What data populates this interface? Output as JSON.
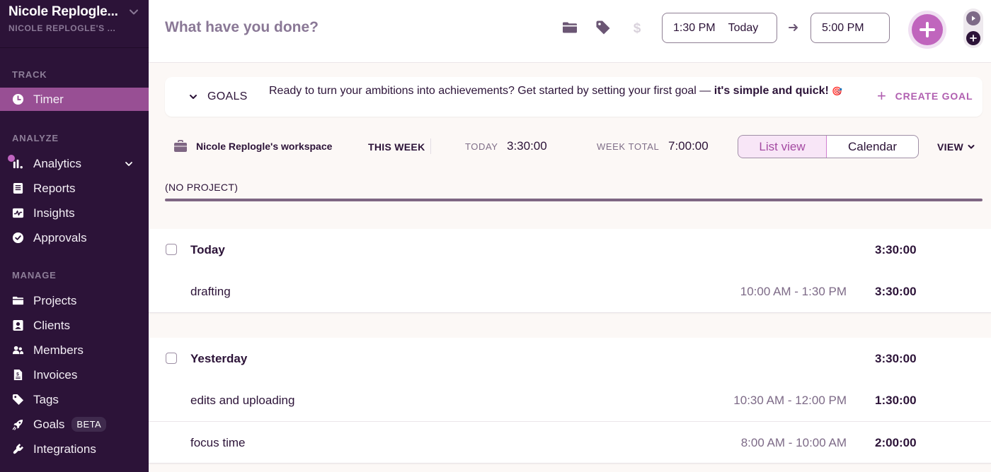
{
  "sidebar": {
    "workspace_name": "Nicole Replogle...",
    "workspace_sub": "NICOLE REPLOGLE'S ...",
    "sections": {
      "track": "TRACK",
      "analyze": "ANALYZE",
      "manage": "MANAGE"
    },
    "items": [
      {
        "label": "Timer",
        "icon": "clock-icon",
        "active": true
      },
      {
        "label": "Analytics",
        "icon": "bar-chart-icon",
        "has_chevron": true,
        "has_dot": true
      },
      {
        "label": "Reports",
        "icon": "document-icon"
      },
      {
        "label": "Insights",
        "icon": "pulse-icon"
      },
      {
        "label": "Approvals",
        "icon": "check-circle-icon"
      },
      {
        "label": "Projects",
        "icon": "folder-icon"
      },
      {
        "label": "Clients",
        "icon": "contact-card-icon"
      },
      {
        "label": "Members",
        "icon": "members-icon"
      },
      {
        "label": "Invoices",
        "icon": "invoice-icon"
      },
      {
        "label": "Tags",
        "icon": "tag-icon"
      },
      {
        "label": "Goals",
        "icon": "rocket-icon",
        "badge": "BETA"
      },
      {
        "label": "Integrations",
        "icon": "plug-icon"
      }
    ]
  },
  "topbar": {
    "description_placeholder": "What have you done?",
    "start_time": "1:30 PM",
    "start_day": "Today",
    "end_time": "5:00 PM",
    "icons": [
      "folder-icon",
      "tag-icon",
      "dollar-icon",
      "arrow-right-icon",
      "add-entry-icon",
      "play-mode-icon",
      "manual-mode-icon"
    ]
  },
  "goals_banner": {
    "toggle_label": "GOALS",
    "message_regular": "Ready to turn your ambitions into achievements? Get started by setting your first goal — ",
    "message_bold": "it's simple and quick!",
    "emoji": "🎯",
    "create_label": "CREATE GOAL"
  },
  "summary": {
    "workspace": "Nicole Replogle's workspace",
    "period": "THIS WEEK",
    "today_label": "TODAY",
    "today_value": "3:30:00",
    "week_total_label": "WEEK TOTAL",
    "week_total_value": "7:00:00",
    "view_options": [
      "List view",
      "Calendar"
    ],
    "selected_view": "List view",
    "view_menu_label": "VIEW"
  },
  "project_breakdown": {
    "label": "(NO PROJECT)",
    "share_percent": 100,
    "color": "#7e6683"
  },
  "days": [
    {
      "label": "Today",
      "total": "3:30:00",
      "entries": [
        {
          "description": "drafting",
          "range": "10:00 AM - 1:30 PM",
          "duration": "3:30:00"
        }
      ]
    },
    {
      "label": "Yesterday",
      "total": "3:30:00",
      "entries": [
        {
          "description": "edits and uploading",
          "range": "10:30 AM - 12:00 PM",
          "duration": "1:30:00"
        },
        {
          "description": "focus time",
          "range": "8:00 AM - 10:00 AM",
          "duration": "2:00:00"
        }
      ]
    }
  ],
  "colors": {
    "sidebar_bg": "#2c1338",
    "active_item": "#984f94",
    "accent": "#c065bd",
    "text": "#2c1338"
  }
}
